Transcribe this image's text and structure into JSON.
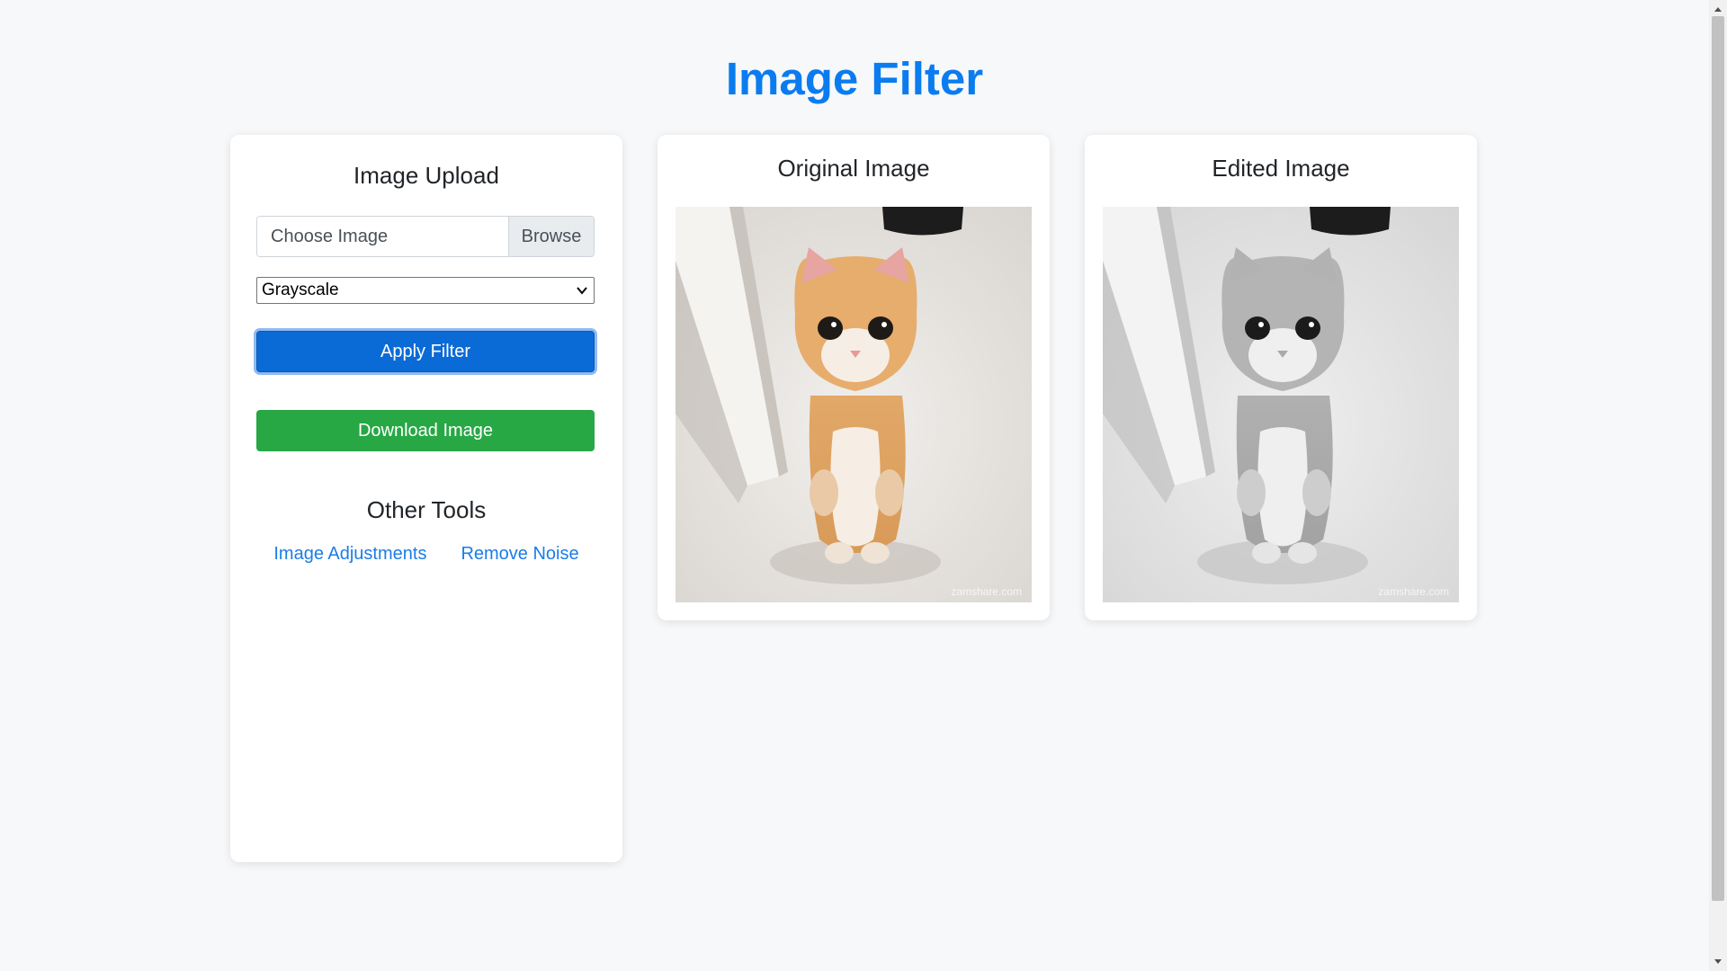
{
  "page": {
    "title": "Image Filter",
    "accent_color": "#0a7cf0"
  },
  "upload": {
    "heading": "Image Upload",
    "file_placeholder": "Choose Image",
    "browse_label": "Browse",
    "filter_value": "Grayscale",
    "apply_label": "Apply Filter",
    "download_label": "Download Image",
    "tools_heading": "Other Tools",
    "tools": [
      {
        "label": "Image Adjustments"
      },
      {
        "label": "Remove Noise"
      }
    ]
  },
  "original": {
    "heading": "Original Image",
    "watermark": "zamshare.com"
  },
  "edited": {
    "heading": "Edited Image",
    "watermark": "zamshare.com"
  },
  "icons": {
    "select_arrow": "chevron-down-icon",
    "scroll_up": "triangle-up-icon",
    "scroll_down": "triangle-down-icon"
  },
  "colors": {
    "apply_button": "#0b6bd6",
    "download_button": "#28a745",
    "link": "#1a7de8"
  }
}
